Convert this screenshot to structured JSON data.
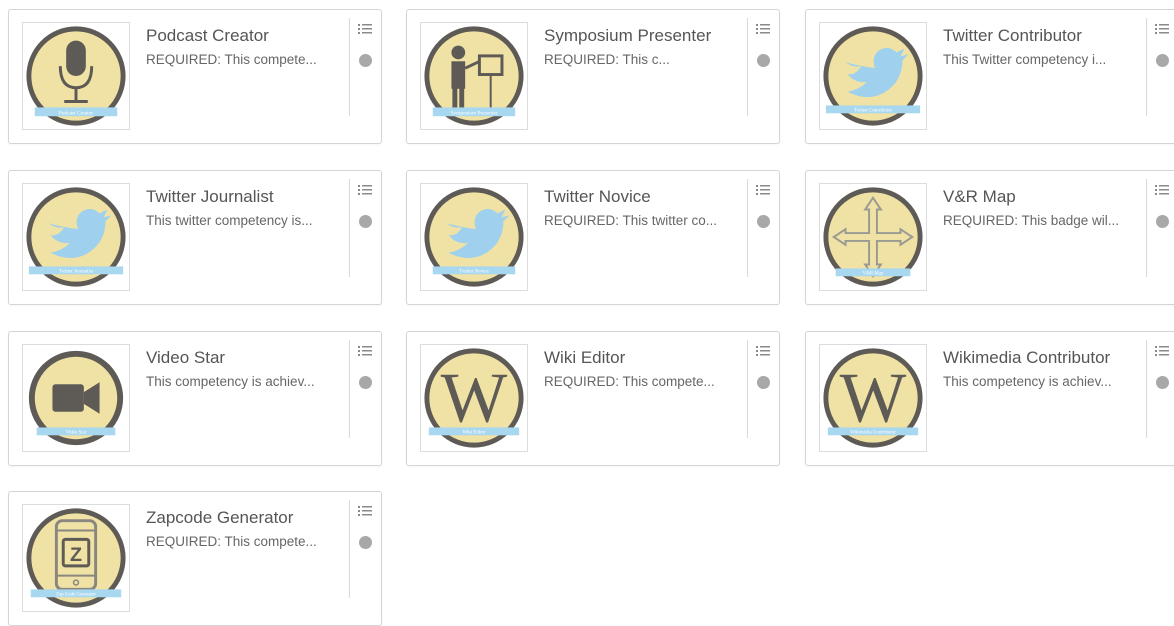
{
  "colors": {
    "badge_fill": "#efe2a4",
    "badge_ring": "#5e5a56",
    "badge_symbol": "#5e5a56",
    "twitter_blue": "#9fd0ee",
    "ribbon": "#a8d7f0",
    "status_dot": "#a8a8a8"
  },
  "badges": [
    {
      "title": "Podcast Creator",
      "description": "REQUIRED: This compete...",
      "icon": "microphone-icon",
      "ribbon_text": "Podcast Creator"
    },
    {
      "title": "Symposium Presenter",
      "description": "REQUIRED: This c...",
      "icon": "presenter-icon",
      "ribbon_text": "Symposium Presenter"
    },
    {
      "title": "Twitter Contributor",
      "description": "This Twitter competency i...",
      "icon": "twitter-bird-icon",
      "ribbon_text": "Twitter Contributor"
    },
    {
      "title": "Twitter Journalist",
      "description": "This twitter competency is...",
      "icon": "twitter-bird-icon",
      "ribbon_text": "Twitter Journalist"
    },
    {
      "title": "Twitter Novice",
      "description": "REQUIRED: This twitter co...",
      "icon": "twitter-bird-icon",
      "ribbon_text": "Twitter Novice"
    },
    {
      "title": "V&R Map",
      "description": "REQUIRED: This badge wil...",
      "icon": "arrows-map-icon",
      "ribbon_text": "V&R Map"
    },
    {
      "title": "Video Star",
      "description": "This competency is achiev...",
      "icon": "video-camera-icon",
      "ribbon_text": "Video Star"
    },
    {
      "title": "Wiki Editor",
      "description": "REQUIRED: This compete...",
      "icon": "wikipedia-w-icon",
      "ribbon_text": "Wiki Editor"
    },
    {
      "title": "Wikimedia Contributor",
      "description": "This competency is achiev...",
      "icon": "wikipedia-w-icon",
      "ribbon_text": "Wikimedia Contributor"
    },
    {
      "title": "Zapcode Generator",
      "description": "REQUIRED: This compete...",
      "icon": "zapcode-phone-icon",
      "ribbon_text": "Zap Code Generator"
    }
  ]
}
